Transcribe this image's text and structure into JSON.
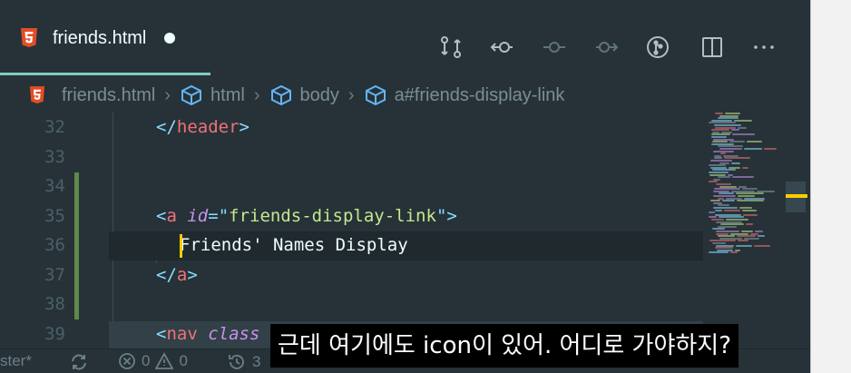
{
  "tab": {
    "icon": "html5-icon",
    "title": "friends.html",
    "dirty": true
  },
  "toolbar": {
    "icons": [
      "git-compare-icon",
      "go-previous-change-icon",
      "commit-icon",
      "go-next-change-icon",
      "git-graph-icon",
      "split-editor-icon",
      "more-actions-icon"
    ]
  },
  "breadcrumb": [
    {
      "icon": "html5-icon",
      "label": "friends.html"
    },
    {
      "icon": "cube-icon",
      "label": "html"
    },
    {
      "icon": "cube-icon",
      "label": "body"
    },
    {
      "icon": "cube-icon",
      "label": "a#friends-display-link"
    }
  ],
  "breadcrumb_separator": "›",
  "code": {
    "lines": [
      {
        "num": "32",
        "tokens": [
          [
            "p",
            "</"
          ],
          [
            "t",
            "header"
          ],
          [
            "p",
            ">"
          ]
        ]
      },
      {
        "num": "33",
        "tokens": []
      },
      {
        "num": "34",
        "tokens": []
      },
      {
        "num": "35",
        "tokens": [
          [
            "p",
            "<"
          ],
          [
            "t",
            "a"
          ],
          [
            "x",
            " "
          ],
          [
            "a",
            "id"
          ],
          [
            "p",
            "="
          ],
          [
            "p",
            "\""
          ],
          [
            "s",
            "friends-display-link"
          ],
          [
            "p",
            "\""
          ],
          [
            "p",
            ">"
          ]
        ]
      },
      {
        "num": "36",
        "indent": 2,
        "tokens": [
          [
            "x",
            "Friends' Names Display"
          ]
        ]
      },
      {
        "num": "37",
        "tokens": [
          [
            "p",
            "</"
          ],
          [
            "t",
            "a"
          ],
          [
            "p",
            ">"
          ]
        ]
      },
      {
        "num": "38",
        "tokens": []
      },
      {
        "num": "39",
        "tokens": [
          [
            "p",
            "<"
          ],
          [
            "t",
            "nav"
          ],
          [
            "x",
            " "
          ],
          [
            "a",
            "class"
          ]
        ]
      }
    ]
  },
  "status": {
    "branch": "ster*",
    "sync_icon": "sync-icon",
    "errors": "0",
    "warnings": "0",
    "history_icon": "history-icon",
    "history_count": "3"
  },
  "subtitle": "근데 여기에도 icon이 있어. 어디로 가야하지?",
  "colors": {
    "background": "#263238",
    "accent": "#80cbc4",
    "tag": "#f07178",
    "punct": "#89ddff",
    "attr": "#c792ea",
    "string": "#c3e88d",
    "html5": "#e44d26",
    "cube": "#64b5f6",
    "caret": "#ffcc00"
  }
}
